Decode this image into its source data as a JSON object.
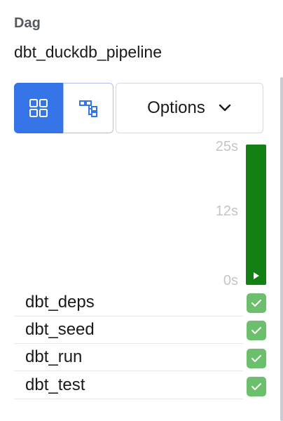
{
  "panel": {
    "section_label": "Dag",
    "dag_name": "dbt_duckdb_pipeline"
  },
  "view_toggle": {
    "active": "grid",
    "grid_icon": "grid-icon",
    "graph_icon": "graph-icon"
  },
  "options": {
    "label": "Options",
    "icon": "chevron-down-icon"
  },
  "duration_axis": {
    "ticks": [
      "25s",
      "12s",
      "0s"
    ]
  },
  "run_bar": {
    "state": "success",
    "color": "#138013",
    "icon": "play-icon"
  },
  "tasks": [
    {
      "label": "dbt_deps",
      "status": "success"
    },
    {
      "label": "dbt_seed",
      "status": "success"
    },
    {
      "label": "dbt_run",
      "status": "success"
    },
    {
      "label": "dbt_test",
      "status": "success"
    }
  ],
  "colors": {
    "accent": "#3474e6",
    "success": "#6cbf6c"
  }
}
